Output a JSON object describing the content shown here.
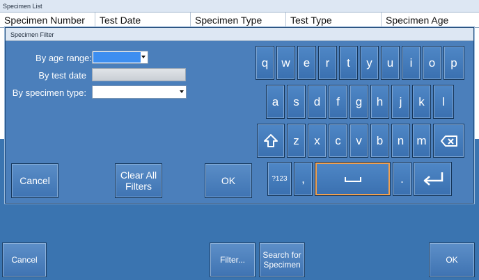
{
  "window": {
    "title": "Specimen List"
  },
  "grid": {
    "columns": [
      "Specimen Number",
      "Test Date",
      "Specimen Type",
      "Test Type",
      "Specimen Age"
    ]
  },
  "bottom_bar": {
    "cancel": "Cancel",
    "filter": "Filter...",
    "search": "Search for Specimen",
    "ok": "OK"
  },
  "dialog": {
    "title": "Specimen Filter",
    "age_label": "By age range:",
    "test_date_label": "By test date",
    "specimen_type_label": "By specimen type:",
    "cancel": "Cancel",
    "clear_all": "Clear All Filters",
    "ok": "OK"
  },
  "keyboard": {
    "row1": [
      "q",
      "w",
      "e",
      "r",
      "t",
      "y",
      "u",
      "i",
      "o",
      "p"
    ],
    "row2": [
      "a",
      "s",
      "d",
      "f",
      "g",
      "h",
      "j",
      "k",
      "l"
    ],
    "row3": [
      "z",
      "x",
      "c",
      "v",
      "b",
      "n",
      "m"
    ],
    "numeric_toggle": "?123",
    "comma": ",",
    "period": ".",
    "icons": {
      "shift": "shift-arrow-icon",
      "backspace": "backspace-icon",
      "space": "spacebar-icon",
      "enter": "enter-icon"
    }
  },
  "colors": {
    "background": "#3a74b0",
    "dialog": "#4b7fbb",
    "selection": "#3d8ef0"
  }
}
